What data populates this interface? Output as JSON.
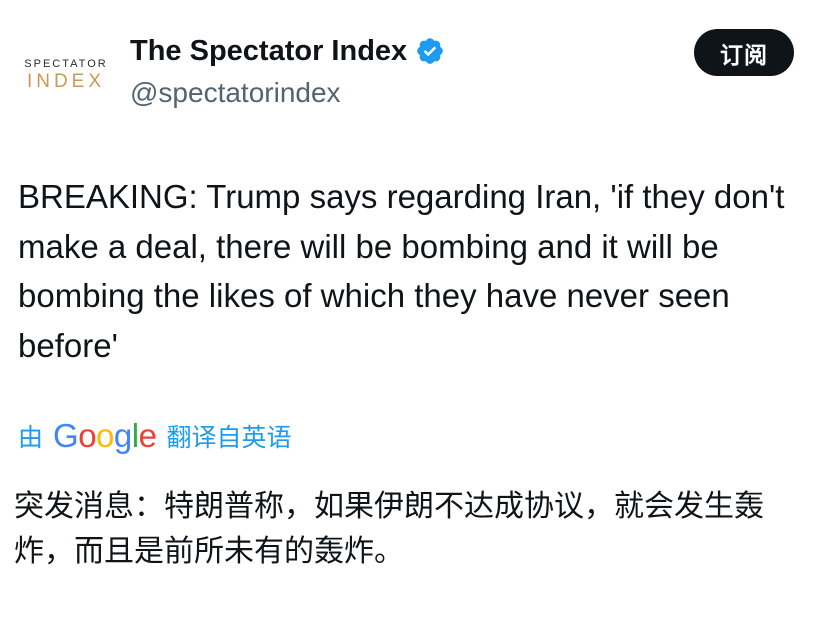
{
  "account": {
    "logo_line1": "SPECTATOR",
    "logo_line2": "INDEX",
    "display_name": "The Spectator Index",
    "handle": "@spectatorindex",
    "verified_icon": "verified-badge-icon",
    "verified_color": "#1d9bf0"
  },
  "subscribe_label": "订阅",
  "tweet": {
    "text": "BREAKING: Trump says regarding Iran, 'if they don't make a deal, there will be bombing and it will be bombing the likes of which they have never seen before'"
  },
  "translation": {
    "by": "由",
    "provider": [
      "G",
      "o",
      "o",
      "g",
      "l",
      "e"
    ],
    "provider_colors": [
      "#4285f4",
      "#ea4335",
      "#fbbc05",
      "#4285f4",
      "#34a853",
      "#ea4335"
    ],
    "from": "翻译自英语",
    "text": "突发消息：特朗普称，如果伊朗不达成协议，就会发生轰炸，而且是前所未有的轰炸。"
  },
  "colors": {
    "link_blue": "#1d9bf0",
    "text_primary": "#0f1419",
    "text_secondary": "#536471",
    "logo_gold": "#c99a54"
  }
}
